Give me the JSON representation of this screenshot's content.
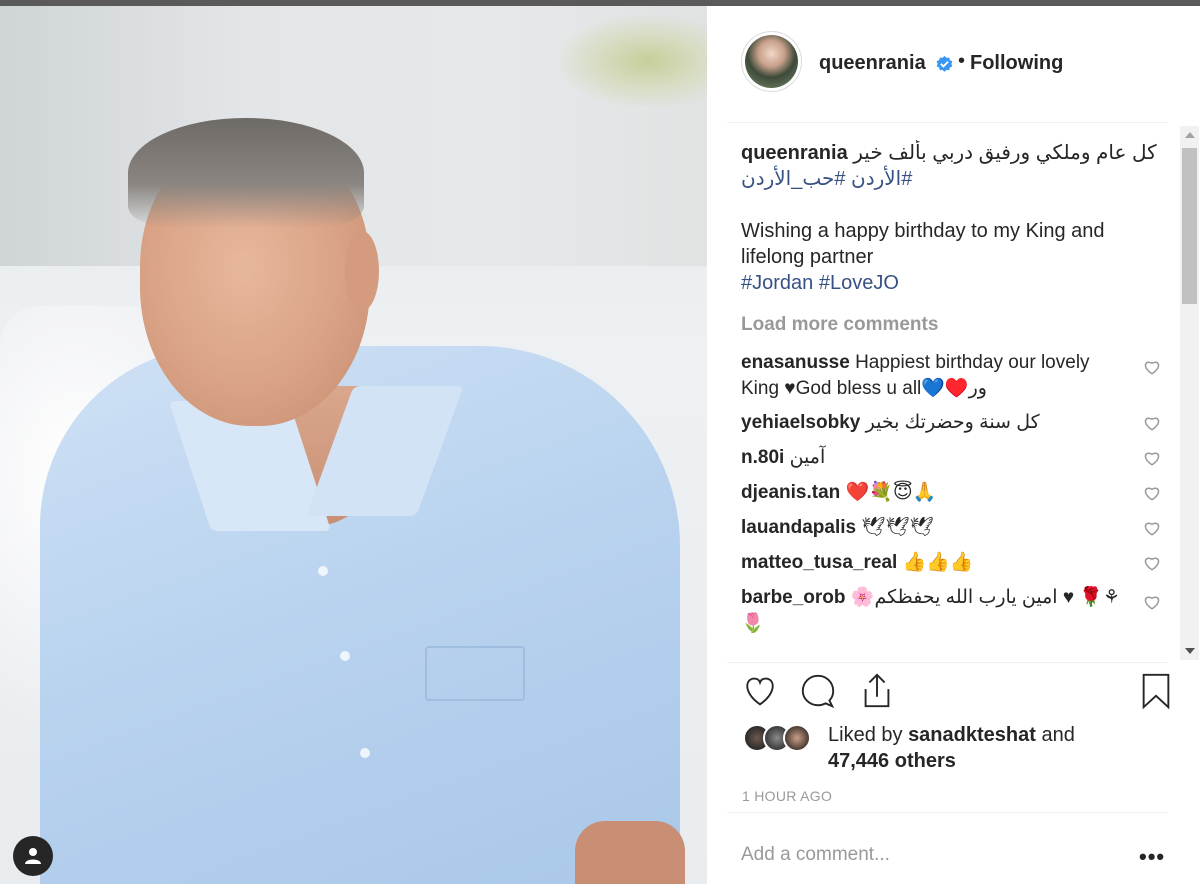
{
  "post": {
    "username": "queenrania",
    "follow_status": "Following",
    "separator": "•",
    "caption": {
      "username": "queenrania",
      "arabic_text": "كل عام وملكي ورفيق دربي بألف خير",
      "arabic_hashtags": "#الأردن #حب_الأردن",
      "english_text": "Wishing a happy birthday to my King and lifelong partner",
      "english_hashtags": "#Jordan #LoveJO"
    },
    "load_more_label": "Load more comments",
    "comments": [
      {
        "user": "enasanusse",
        "text": "Happiest birthday our lovely King ♥God bless u all💙♥️ور"
      },
      {
        "user": "yehiaelsobky",
        "text": "كل سنة وحضرتك بخير"
      },
      {
        "user": "n.80i",
        "text": "آمين"
      },
      {
        "user": "djeanis.tan",
        "text": "❤️💐😇🙏"
      },
      {
        "user": "lauandapalis",
        "text": "🕊🕊🕊"
      },
      {
        "user": "matteo_tusa_real",
        "text": "👍👍👍"
      },
      {
        "user": "barbe_orob",
        "text": "🌸امين يارب الله يحفظكم ♥ 🌹⚘🌷"
      }
    ],
    "liked_by": {
      "prefix": "Liked by",
      "user": "sanadkteshat",
      "conj": "and",
      "count": "47,446 others"
    },
    "timestamp": "1 HOUR AGO",
    "add_comment_placeholder": "Add a comment...",
    "more_label": "•••"
  },
  "icons": {
    "like": "heart-icon",
    "comment": "comment-icon",
    "share": "share-icon",
    "save": "bookmark-icon",
    "verified": "verified-badge-icon",
    "user": "user-icon"
  },
  "colors": {
    "link": "#385185",
    "muted": "#999999",
    "verified": "#3897f0",
    "text": "#262626"
  }
}
